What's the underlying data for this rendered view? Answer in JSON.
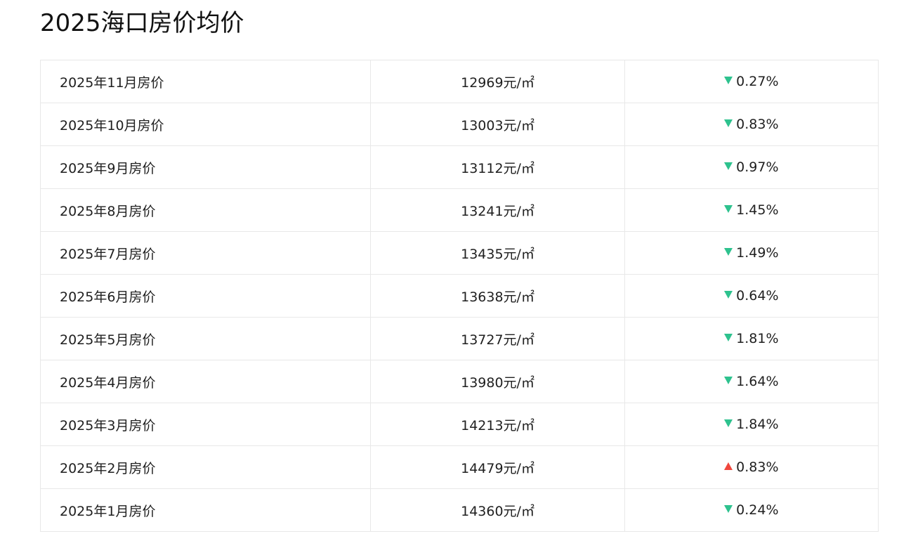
{
  "title": "2025海口房价均价",
  "colors": {
    "down": "#2ec28e",
    "up": "#f0473d"
  },
  "rows": [
    {
      "month": "2025年11月房价",
      "price": "12969元/㎡",
      "direction": "down",
      "icon": "arrow-down-icon",
      "change": "0.27%"
    },
    {
      "month": "2025年10月房价",
      "price": "13003元/㎡",
      "direction": "down",
      "icon": "arrow-down-icon",
      "change": "0.83%"
    },
    {
      "month": "2025年9月房价",
      "price": "13112元/㎡",
      "direction": "down",
      "icon": "arrow-down-icon",
      "change": "0.97%"
    },
    {
      "month": "2025年8月房价",
      "price": "13241元/㎡",
      "direction": "down",
      "icon": "arrow-down-icon",
      "change": "1.45%"
    },
    {
      "month": "2025年7月房价",
      "price": "13435元/㎡",
      "direction": "down",
      "icon": "arrow-down-icon",
      "change": "1.49%"
    },
    {
      "month": "2025年6月房价",
      "price": "13638元/㎡",
      "direction": "down",
      "icon": "arrow-down-icon",
      "change": "0.64%"
    },
    {
      "month": "2025年5月房价",
      "price": "13727元/㎡",
      "direction": "down",
      "icon": "arrow-down-icon",
      "change": "1.81%"
    },
    {
      "month": "2025年4月房价",
      "price": "13980元/㎡",
      "direction": "down",
      "icon": "arrow-down-icon",
      "change": "1.64%"
    },
    {
      "month": "2025年3月房价",
      "price": "14213元/㎡",
      "direction": "down",
      "icon": "arrow-down-icon",
      "change": "1.84%"
    },
    {
      "month": "2025年2月房价",
      "price": "14479元/㎡",
      "direction": "up",
      "icon": "arrow-up-icon",
      "change": "0.83%"
    },
    {
      "month": "2025年1月房价",
      "price": "14360元/㎡",
      "direction": "down",
      "icon": "arrow-down-icon",
      "change": "0.24%"
    }
  ]
}
